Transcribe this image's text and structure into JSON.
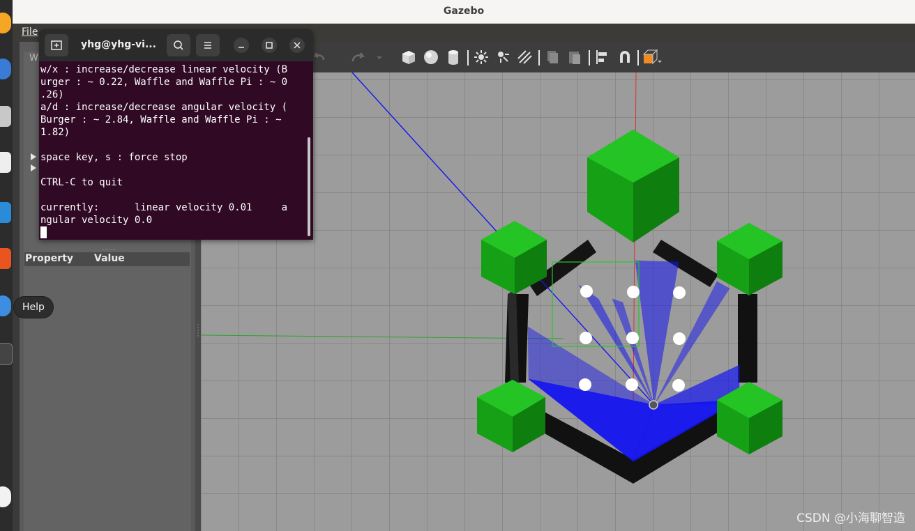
{
  "window": {
    "title": "Gazebo"
  },
  "menubar": {
    "file_label": "File"
  },
  "left_panel": {
    "header_partial": "W",
    "property_col": "Property",
    "value_col": "Value"
  },
  "dock": {
    "tooltip": "Help"
  },
  "terminal": {
    "title": "yhg@yhg-vi...",
    "lines": [
      "w/x : increase/decrease linear velocity (B",
      "urger : ~ 0.22, Waffle and Waffle Pi : ~ 0",
      ".26)",
      "a/d : increase/decrease angular velocity (",
      "Burger : ~ 2.84, Waffle and Waffle Pi : ~",
      "1.82)",
      "",
      "space key, s : force stop",
      "",
      "CTRL-C to quit",
      "",
      "currently:      linear velocity 0.01     a",
      "ngular velocity 0.0"
    ]
  },
  "watermark": "CSDN @小海聊智造",
  "icons": [
    "terminal-new-tab-icon",
    "search-icon",
    "menu-icon",
    "minimize-icon",
    "maximize-icon",
    "close-icon",
    "undo-icon",
    "redo-icon",
    "box-icon",
    "sphere-icon",
    "cylinder-icon",
    "point-light-icon",
    "spot-light-icon",
    "directional-light-icon",
    "copy-icon",
    "paste-icon",
    "align-icon",
    "magnet-icon",
    "view-angle-icon"
  ],
  "colors": {
    "terminal_bg": "#300a24",
    "grid_bg": "#9b9b9b",
    "obstacle_green": "#1ea51e",
    "laser_blue": "#1515f0"
  }
}
